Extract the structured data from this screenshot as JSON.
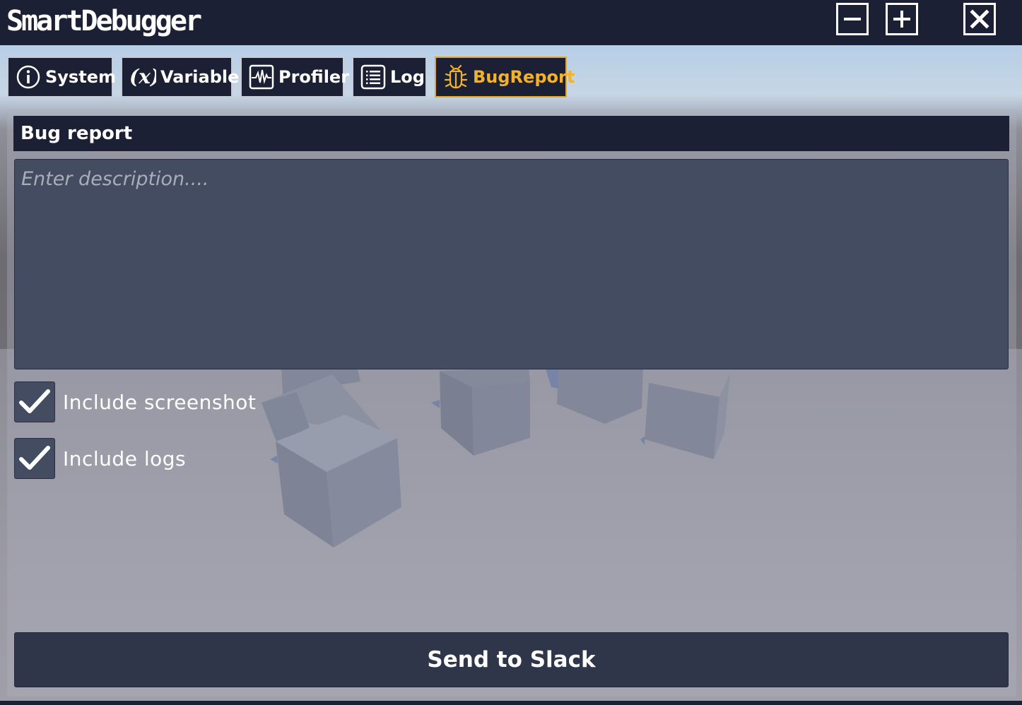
{
  "window": {
    "title": "SmartDebugger",
    "controls": [
      "minimize",
      "maximize",
      "close"
    ]
  },
  "tabs": [
    {
      "label": "System",
      "icon": "info-circle-icon",
      "active": false
    },
    {
      "label": "Variable",
      "icon": "variable-x-icon",
      "active": false
    },
    {
      "label": "Profiler",
      "icon": "waveform-icon",
      "active": false
    },
    {
      "label": "Log",
      "icon": "list-icon",
      "active": false
    },
    {
      "label": "BugReport",
      "icon": "bug-icon",
      "active": true
    }
  ],
  "bug_report": {
    "header": "Bug report",
    "description_placeholder": "Enter description....",
    "description_value": "",
    "include_screenshot": {
      "label": "Include screenshot",
      "checked": true
    },
    "include_logs": {
      "label": "Include logs",
      "checked": true
    },
    "send_button": "Send to Slack"
  },
  "colors": {
    "chrome": "#1b2034",
    "active_tab": "#f3b22b",
    "field": "#444c61",
    "button": "#30364a"
  }
}
